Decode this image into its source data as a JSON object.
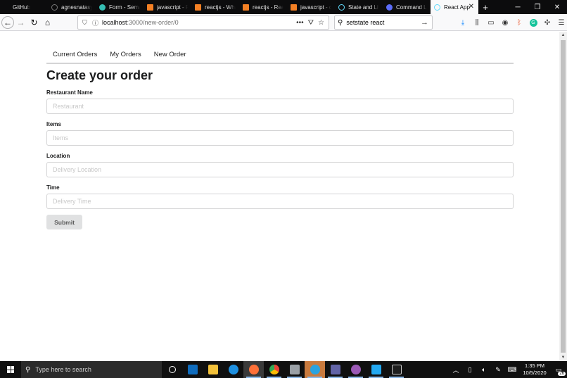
{
  "tabs": [
    {
      "label": "GitHub",
      "icon": "github-icon",
      "icon_color": "#0c0c0d",
      "active": false
    },
    {
      "label": "agnesnatasya",
      "icon": "github-icon",
      "icon_color": "#0c0c0d",
      "active": false
    },
    {
      "label": "Form - Seman",
      "icon": "semantic-ui-icon",
      "icon_color": "#35bdb2",
      "active": false
    },
    {
      "label": "javascript - Re",
      "icon": "stackoverflow-icon",
      "icon_color": "#f48024",
      "active": false
    },
    {
      "label": "reactjs - Wha",
      "icon": "stackoverflow-icon",
      "icon_color": "#f48024",
      "active": false
    },
    {
      "label": "reactjs - Reac",
      "icon": "stackoverflow-icon",
      "icon_color": "#f48024",
      "active": false
    },
    {
      "label": "javascript - o",
      "icon": "stackoverflow-icon",
      "icon_color": "#f48024",
      "active": false
    },
    {
      "label": "State and Life",
      "icon": "react-icon",
      "icon_color": "#61dafb",
      "active": false
    },
    {
      "label": "Command Lin",
      "icon": "moon-icon",
      "icon_color": "#5b6cf9",
      "active": false
    },
    {
      "label": "React App",
      "icon": "react-icon",
      "icon_color": "#61dafb",
      "active": true
    }
  ],
  "address_bar": {
    "host": "localhost",
    "path": ":3000/new-order/0"
  },
  "search_bar": {
    "value": "setstate react"
  },
  "app_menu": {
    "items": [
      "Current Orders",
      "My Orders",
      "New Order"
    ]
  },
  "form": {
    "title": "Create your order",
    "fields": [
      {
        "label": "Restaurant Name",
        "placeholder": "Restaurant"
      },
      {
        "label": "Items",
        "placeholder": "Items"
      },
      {
        "label": "Location",
        "placeholder": "Delivery Location"
      },
      {
        "label": "Time",
        "placeholder": "Delivery Time"
      }
    ],
    "submit_label": "Submit"
  },
  "taskbar": {
    "search_placeholder": "Type here to search",
    "time": "1:35 PM",
    "date": "10/5/2020",
    "notification_count": "26",
    "apps": [
      {
        "name": "task-view-icon",
        "color": "#ffffff"
      },
      {
        "name": "outlook-icon",
        "color": "#0f6cbd"
      },
      {
        "name": "file-explorer-icon",
        "color": "#f3c13a"
      },
      {
        "name": "edge-icon",
        "color": "#1e90e0"
      },
      {
        "name": "firefox-icon",
        "color": "#ff7139"
      },
      {
        "name": "chrome-icon",
        "color": "#34a853"
      },
      {
        "name": "generic-app-icon",
        "color": "#9aa0a6"
      },
      {
        "name": "telegram-icon",
        "color": "#2aa3e0"
      },
      {
        "name": "teams-icon",
        "color": "#6264a7"
      },
      {
        "name": "github-desktop-icon",
        "color": "#9b59b6"
      },
      {
        "name": "vscode-icon",
        "color": "#23a9f2"
      },
      {
        "name": "terminal-icon",
        "color": "#1e1e1e"
      }
    ]
  }
}
